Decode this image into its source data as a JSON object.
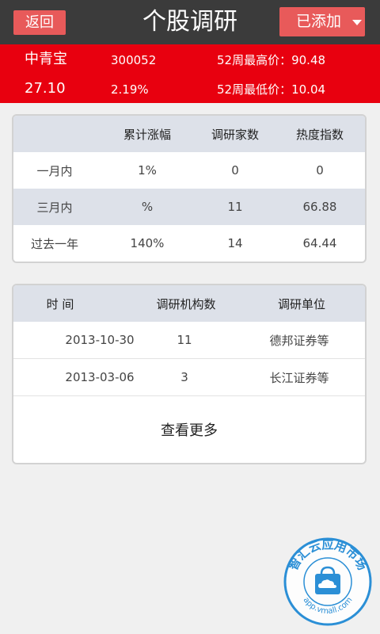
{
  "header": {
    "back_label": "返回",
    "title": "个股调研",
    "added_label": "已添加"
  },
  "stock": {
    "name": "中青宝",
    "code": "300052",
    "price": "27.10",
    "change": "2.19%",
    "high52_label": "52周最高价：90.48",
    "low52_label": "52周最低价：10.04"
  },
  "summary": {
    "headers": [
      "",
      "累计涨幅",
      "调研家数",
      "热度指数"
    ],
    "rows": [
      [
        "一月内",
        "1%",
        "0",
        "0"
      ],
      [
        "三月内",
        "%",
        "11",
        "66.88"
      ],
      [
        "过去一年",
        "140%",
        "14",
        "64.44"
      ]
    ]
  },
  "research": {
    "headers": [
      "时 间",
      "调研机构数",
      "调研单位"
    ],
    "rows": [
      [
        "2013-10-30",
        "11",
        "德邦证券等"
      ],
      [
        "2013-03-06",
        "3",
        "长江证券等"
      ]
    ],
    "more_label": "查看更多"
  },
  "watermark": {
    "text": "智汇云应用市场",
    "url": "app.vmall.com",
    "icon": "cloud-bag-icon"
  },
  "colors": {
    "topbar": "#3b3b3b",
    "button": "#e85a5a",
    "stockbar": "#e8000f",
    "header_row": "#dde1e9",
    "watermark": "#2b8fd6"
  }
}
